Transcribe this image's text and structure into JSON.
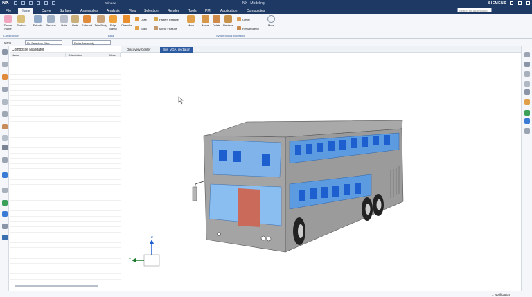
{
  "app": {
    "logo": "NX",
    "title": "NX - Modeling",
    "brand": "SIEMENS",
    "window_menu": "Window"
  },
  "menu": {
    "tabs": [
      "File",
      "Home",
      "Curve",
      "Surface",
      "Assemblies",
      "Analysis",
      "View",
      "Selection",
      "Render",
      "Tools",
      "PMI",
      "Application",
      "Composites"
    ],
    "active": "Home",
    "search_placeholder": "Search for a command"
  },
  "ribbon": {
    "buttons": [
      "Datum Plane",
      "Sketch",
      "Extrude",
      "Revolve",
      "Hole",
      "Unite",
      "Subtract",
      "Trim Body",
      "Edge Blend",
      "Chamfer"
    ],
    "small": {
      "draft": "Draft",
      "shell": "Shell",
      "pattern": "Pattern Feature",
      "mirror": "Mirror Feature",
      "move": "Move",
      "move2": "Move",
      "delete": "Delete",
      "replace": "Replace",
      "offset": "Offset",
      "resize": "Resize Blend",
      "more1": "More",
      "more2": "More"
    },
    "groups": {
      "construction": "Construction",
      "base": "Base",
      "sync": "Synchronous Modeling"
    }
  },
  "toolbar2": {
    "menu": "Menu",
    "filter": "No Selection Filter",
    "scope": "Entire Assembly"
  },
  "navigator": {
    "title": "Composite Navigator",
    "columns": [
      "Name",
      "Orientation",
      "Mate"
    ]
  },
  "doc_tabs": [
    "Discovery Center",
    "Bus_VDA_rev1a.prt"
  ],
  "triad": {
    "z": "Z",
    "y": "Y"
  },
  "status": {
    "notifications": "1 Notification"
  },
  "colors": {
    "title_bg": "#1e3a64",
    "accent": "#2c5aa0",
    "glass": "#6fa8e6",
    "seats": "#1d5fcf",
    "body": "#9a9a9a"
  }
}
